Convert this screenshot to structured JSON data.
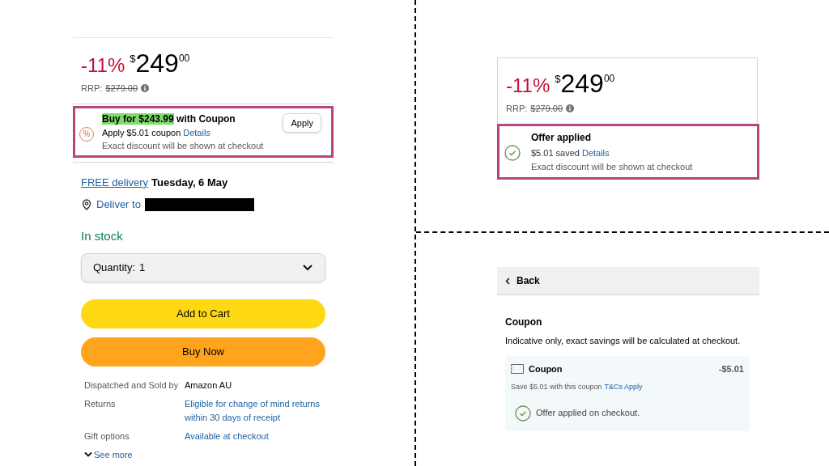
{
  "product_panel": {
    "price": {
      "discount": "-11%",
      "currency": "$",
      "whole": "249",
      "fraction": "00",
      "rrp_label": "RRP:",
      "rrp_value": "$279.00"
    },
    "coupon": {
      "symbol": "%",
      "highlight": "Buy for $243.99",
      "title_rest": "with Coupon",
      "line": "Apply $5.01 coupon",
      "details_link": "Details",
      "note": "Exact discount will be shown at checkout",
      "button": "Apply"
    },
    "delivery": {
      "link": "FREE delivery",
      "date": "Tuesday, 6 May"
    },
    "deliver_to": "Deliver to",
    "stock": "In stock",
    "quantity": {
      "label": "Quantity:",
      "value": "1"
    },
    "buttons": [
      {
        "label": "Add to Cart",
        "kind": "cart"
      },
      {
        "label": "Buy Now",
        "kind": "buy"
      }
    ],
    "details": [
      {
        "label": "Dispatched and Sold by",
        "value": "Amazon AU",
        "kind": "text"
      },
      {
        "label": "Returns",
        "value": "Eligible for change of mind returns within 30 days of receipt",
        "kind": "link"
      },
      {
        "label": "Gift options",
        "value": "Available at checkout",
        "kind": "link"
      }
    ],
    "see_more": "See more"
  },
  "applied_panel": {
    "price": {
      "discount": "-11%",
      "currency": "$",
      "whole": "249",
      "fraction": "00",
      "rrp_label": "RRP:",
      "rrp_value": "$279.00"
    },
    "offer": {
      "title": "Offer applied",
      "saved": "$5.01 saved",
      "details_link": "Details",
      "note": "Exact discount will be shown at checkout"
    }
  },
  "coupon_page": {
    "back": "Back",
    "heading": "Coupon",
    "note": "Indicative only, exact savings will be calculated at checkout.",
    "coupon": {
      "title": "Coupon",
      "amount": "-$5.01",
      "description": "Save $5.01 with this coupon",
      "link": "T&Cs Apply",
      "status": "Offer applied on checkout."
    }
  }
}
